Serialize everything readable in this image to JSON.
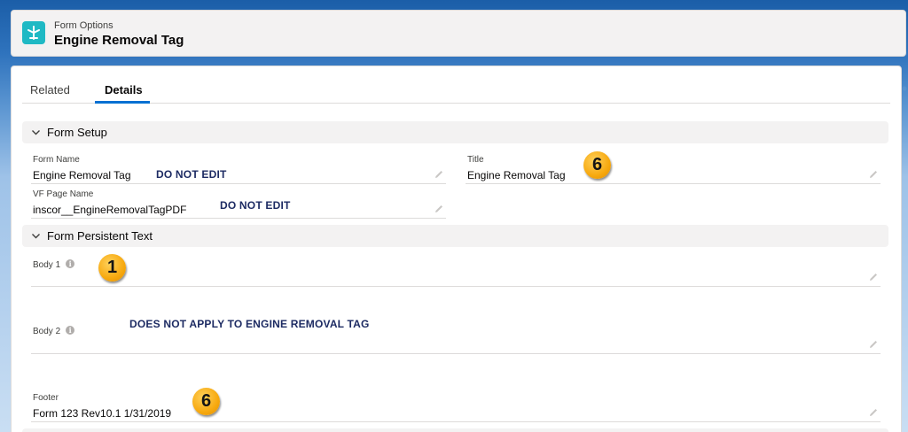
{
  "header": {
    "object_label": "Form Options",
    "record_title": "Engine Removal Tag",
    "icon": "form-icon",
    "icon_color": "#1fb9c4"
  },
  "tabs": [
    {
      "label": "Related",
      "active": false
    },
    {
      "label": "Details",
      "active": true
    }
  ],
  "accent_color": "#0070d2",
  "sections": {
    "form_setup": {
      "title": "Form Setup",
      "fields": {
        "form_name": {
          "label": "Form Name",
          "value": "Engine Removal Tag"
        },
        "title": {
          "label": "Title",
          "value": "Engine Removal Tag"
        },
        "vf_page_name": {
          "label": "VF Page Name",
          "value": "inscor__EngineRemovalTagPDF"
        }
      }
    },
    "form_persistent_text": {
      "title": "Form Persistent Text",
      "fields": {
        "body1": {
          "label": "Body 1",
          "value": ""
        },
        "body2": {
          "label": "Body 2",
          "value": ""
        },
        "footer": {
          "label": "Footer",
          "value": "Form 123 Rev10.1 1/31/2019"
        }
      }
    }
  },
  "annotations": {
    "do_not_edit_1": "DO NOT EDIT",
    "do_not_edit_2": "DO NOT EDIT",
    "does_not_apply": "DOES NOT APPLY TO ENGINE REMOVAL TAG",
    "badge_title": "6",
    "badge_body1": "1",
    "badge_footer": "6"
  }
}
